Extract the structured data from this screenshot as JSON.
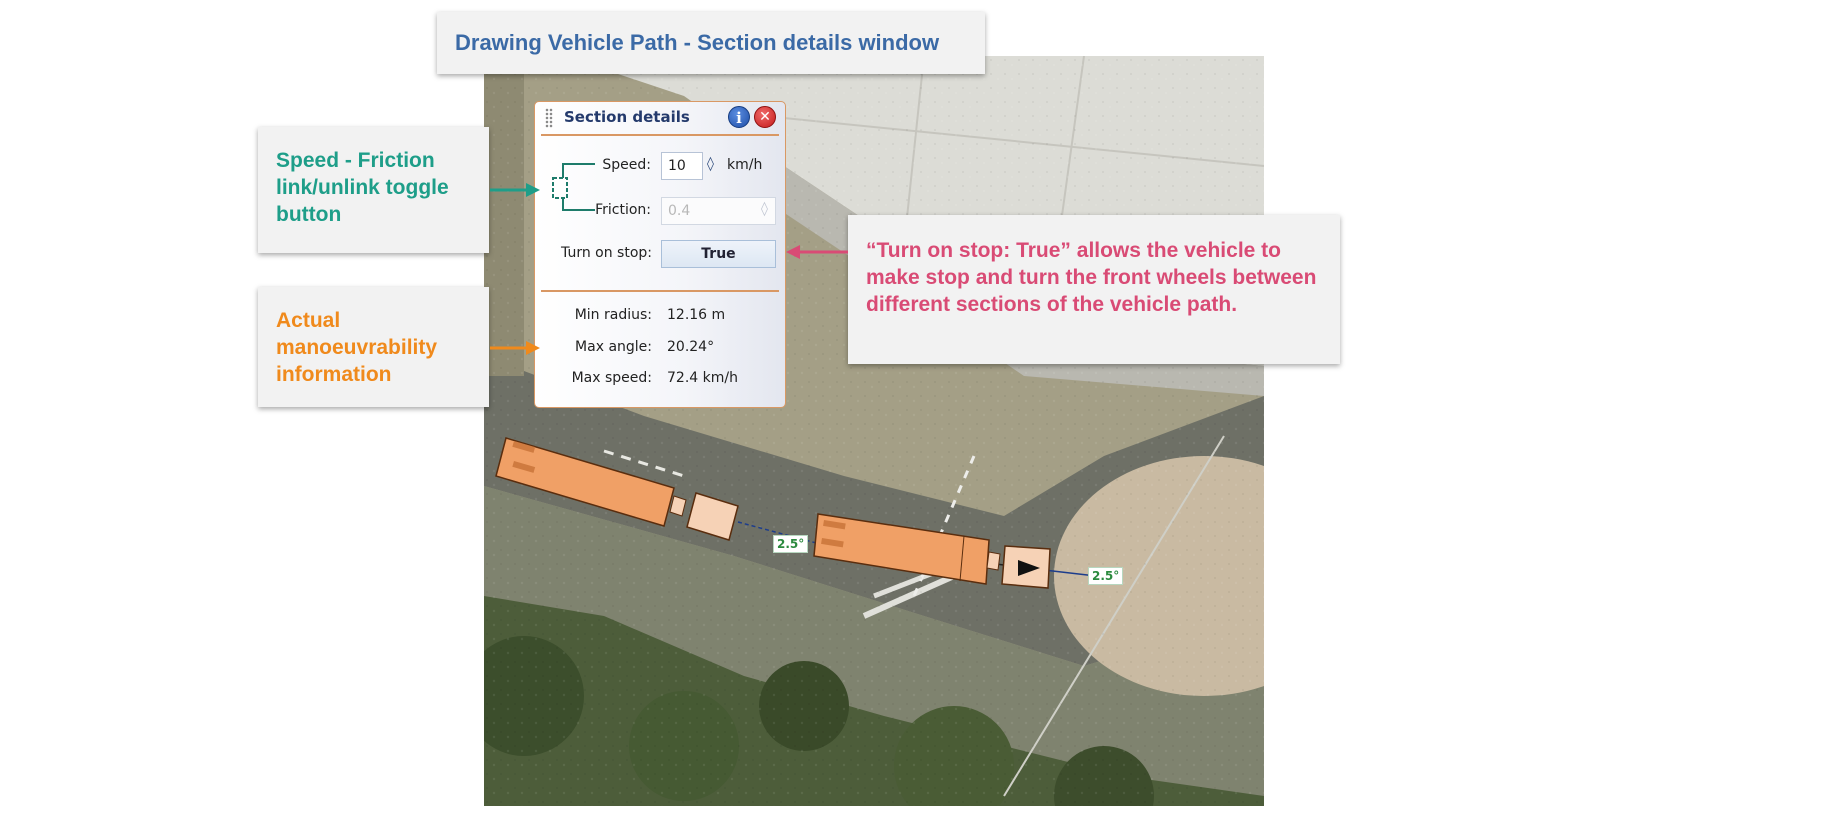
{
  "title_callout": "Drawing Vehicle Path - Section details window",
  "callouts": {
    "speed_friction": "Speed - Friction link/unlink toggle button",
    "manoeuvrability": "Actual manoeuvrability information",
    "turn_on_stop": "“Turn on stop: True” allows the vehicle to make stop and turn the front wheels between different sections of the vehicle path."
  },
  "panel": {
    "title": "Section details",
    "info_icon": "i",
    "close_icon": "✕",
    "speed_label": "Speed:",
    "speed_value": "10",
    "speed_unit": "km/h",
    "friction_label": "Friction:",
    "friction_value": "0.4",
    "turn_on_stop_label": "Turn on stop:",
    "turn_on_stop_value": "True",
    "min_radius_label": "Min radius:",
    "min_radius_value": "12.16 m",
    "max_angle_label": "Max angle:",
    "max_angle_value": "20.24°",
    "max_speed_label": "Max speed:",
    "max_speed_value": "72.4 km/h"
  },
  "map": {
    "angle_label_1": "2.5°",
    "angle_label_2": "2.5°"
  },
  "colors": {
    "title": "#3b6aa6",
    "speed_callout": "#1e9e89",
    "manoeuvre_callout": "#f08a1c",
    "turn_callout": "#d94b75",
    "vehicle": "#f0a066",
    "panel_border": "#d99864"
  },
  "icons": {
    "grip": "grip-icon",
    "info": "info-icon",
    "close": "close-icon",
    "link": "link-toggle-icon",
    "spinner": "spinner-icon",
    "arrow": "direction-arrow-icon"
  }
}
